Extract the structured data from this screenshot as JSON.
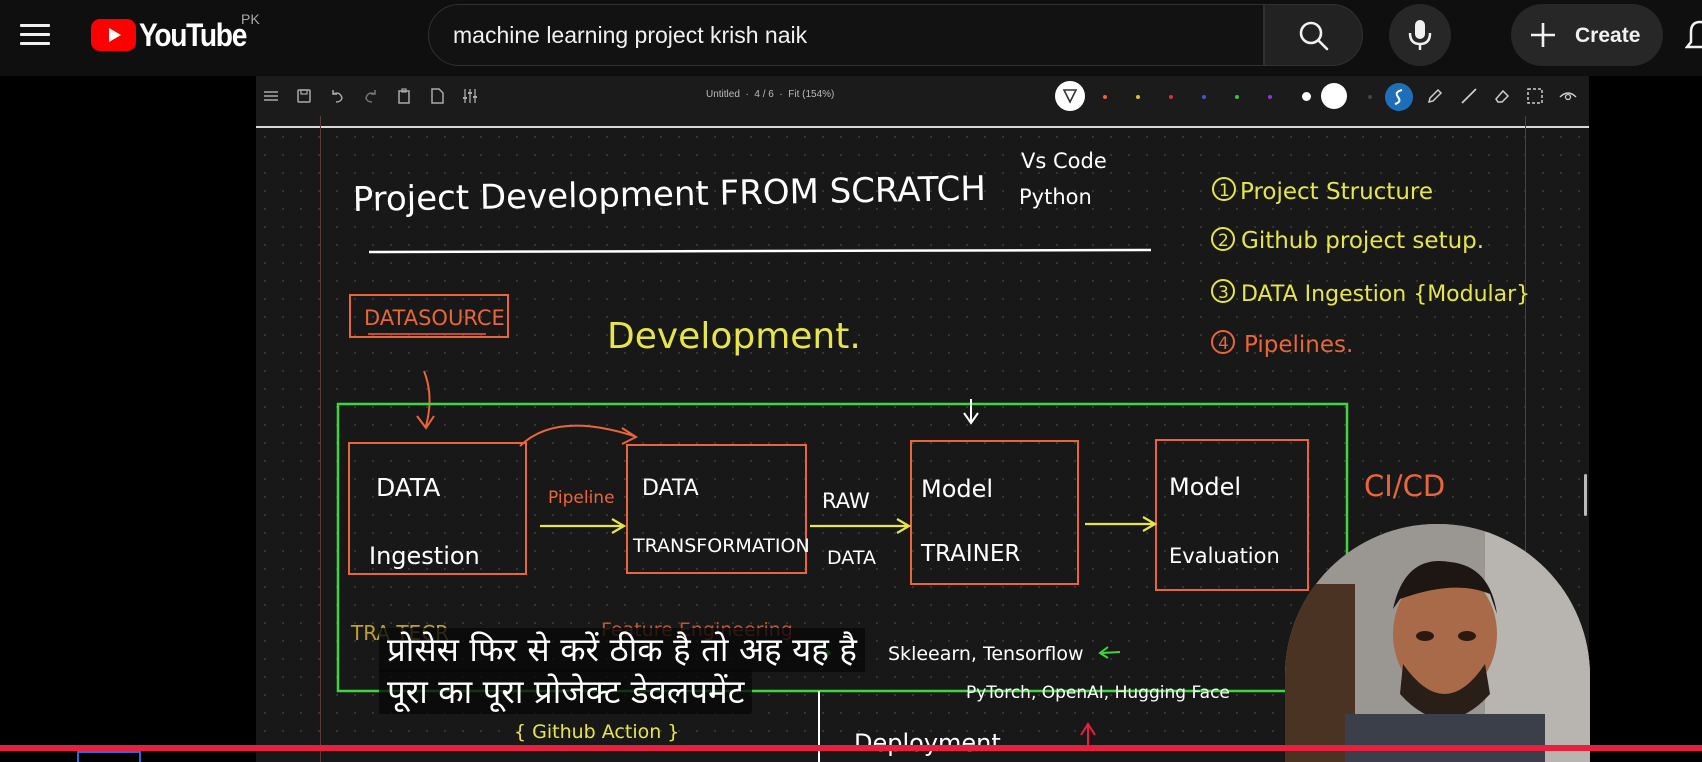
{
  "masthead": {
    "logo_text": "YouTube",
    "country_code": "PK",
    "search": {
      "value": "machine learning project krish naik",
      "placeholder": "Search"
    },
    "create_label": "Create",
    "icons": [
      "menu-icon",
      "youtube-logo",
      "search-icon",
      "mic-icon",
      "plus-icon",
      "bell-icon"
    ]
  },
  "video": {
    "app_toolbar": {
      "doc_title": "Untitled  ·  4 / 6  ·  Fit (154%)",
      "colors": [
        "#e8663a",
        "#d6c23a",
        "#c83a3a",
        "#3a5ac8",
        "#4ab84a",
        "#8a3ac8",
        "#ffffff"
      ]
    },
    "whiteboard": {
      "title": "Project Development FROM SCRATCH",
      "tools": [
        "Vs Code",
        "Python"
      ],
      "agenda": [
        "Project Structure",
        "Github project setup.",
        "DATA Ingestion {Modular}",
        "Pipelines."
      ],
      "agenda_numbers": [
        "1",
        "2",
        "3",
        "4"
      ],
      "datasource": "DATASOURCE",
      "section_label": "Development.",
      "boxes": [
        {
          "line1": "DATA",
          "line2": "Ingestion"
        },
        {
          "line1": "DATA",
          "line2": "TRANSFORMATION"
        },
        {
          "line1": "Model",
          "line2": "TRAINER"
        },
        {
          "line1": "Model",
          "line2": "Evaluation"
        }
      ],
      "arrow_labels": {
        "pipeline": "Pipeline",
        "raw": "RAW",
        "data": "DATA"
      },
      "cicd": "CI/CD",
      "libraries": "Skleearn, Tensorflow",
      "libraries_2": "PyTorch, OpenAI, Hugging Face",
      "github_action": "{ Github Action }",
      "deployment": "Deployment",
      "partial_left": "TRA TECR",
      "partial_mid": "Feature Engineering"
    },
    "captions": {
      "line1": "प्रोसेस फिर से करें ठीक है तो अह यह है",
      "line2": "पूरा का पूरा प्रोजेक्ट डेवलपमेंट"
    },
    "progress_color": "#e8203e"
  }
}
